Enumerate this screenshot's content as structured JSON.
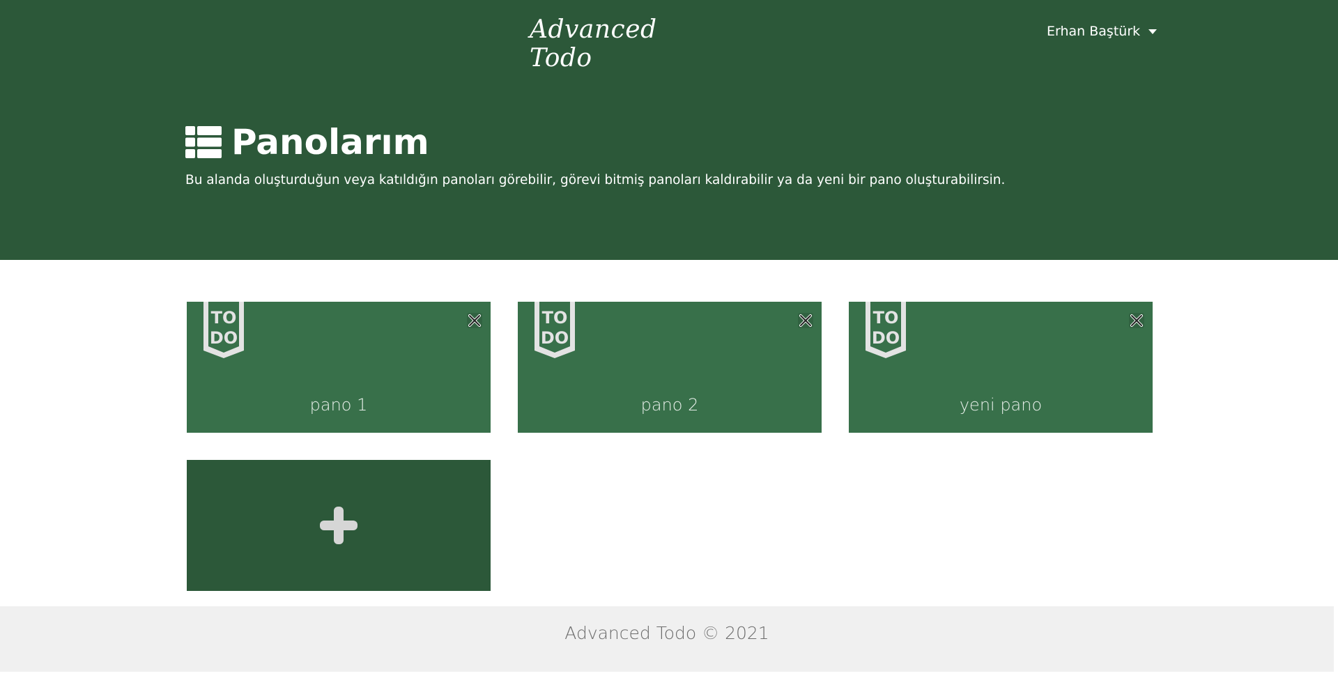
{
  "header": {
    "brand": "Advanced Todo",
    "user_name": "Erhan Baştürk"
  },
  "page": {
    "title": "Panolarım",
    "subtitle": "Bu alanda oluşturduğun veya katıldığın panoları görebilir, görevi bitmiş panoları kaldırabilir ya da yeni bir pano oluşturabilirsin."
  },
  "boards": [
    {
      "name": "pano 1",
      "logo_text": [
        "TO",
        "DO"
      ]
    },
    {
      "name": "pano 2",
      "logo_text": [
        "TO",
        "DO"
      ]
    },
    {
      "name": "yeni pano",
      "logo_text": [
        "TO",
        "DO"
      ]
    }
  ],
  "footer": {
    "text": "Advanced Todo © 2021"
  },
  "colors": {
    "header_bg": "#2c5839",
    "board_bg": "#38704a",
    "add_board_bg": "#2c5839",
    "footer_bg": "#f0f0f0"
  },
  "icons": {
    "title": "list-icon",
    "board_logo": "todo-badge-icon",
    "board_close": "close-icon",
    "add_board": "plus-icon",
    "user_menu": "caret-down-icon"
  }
}
